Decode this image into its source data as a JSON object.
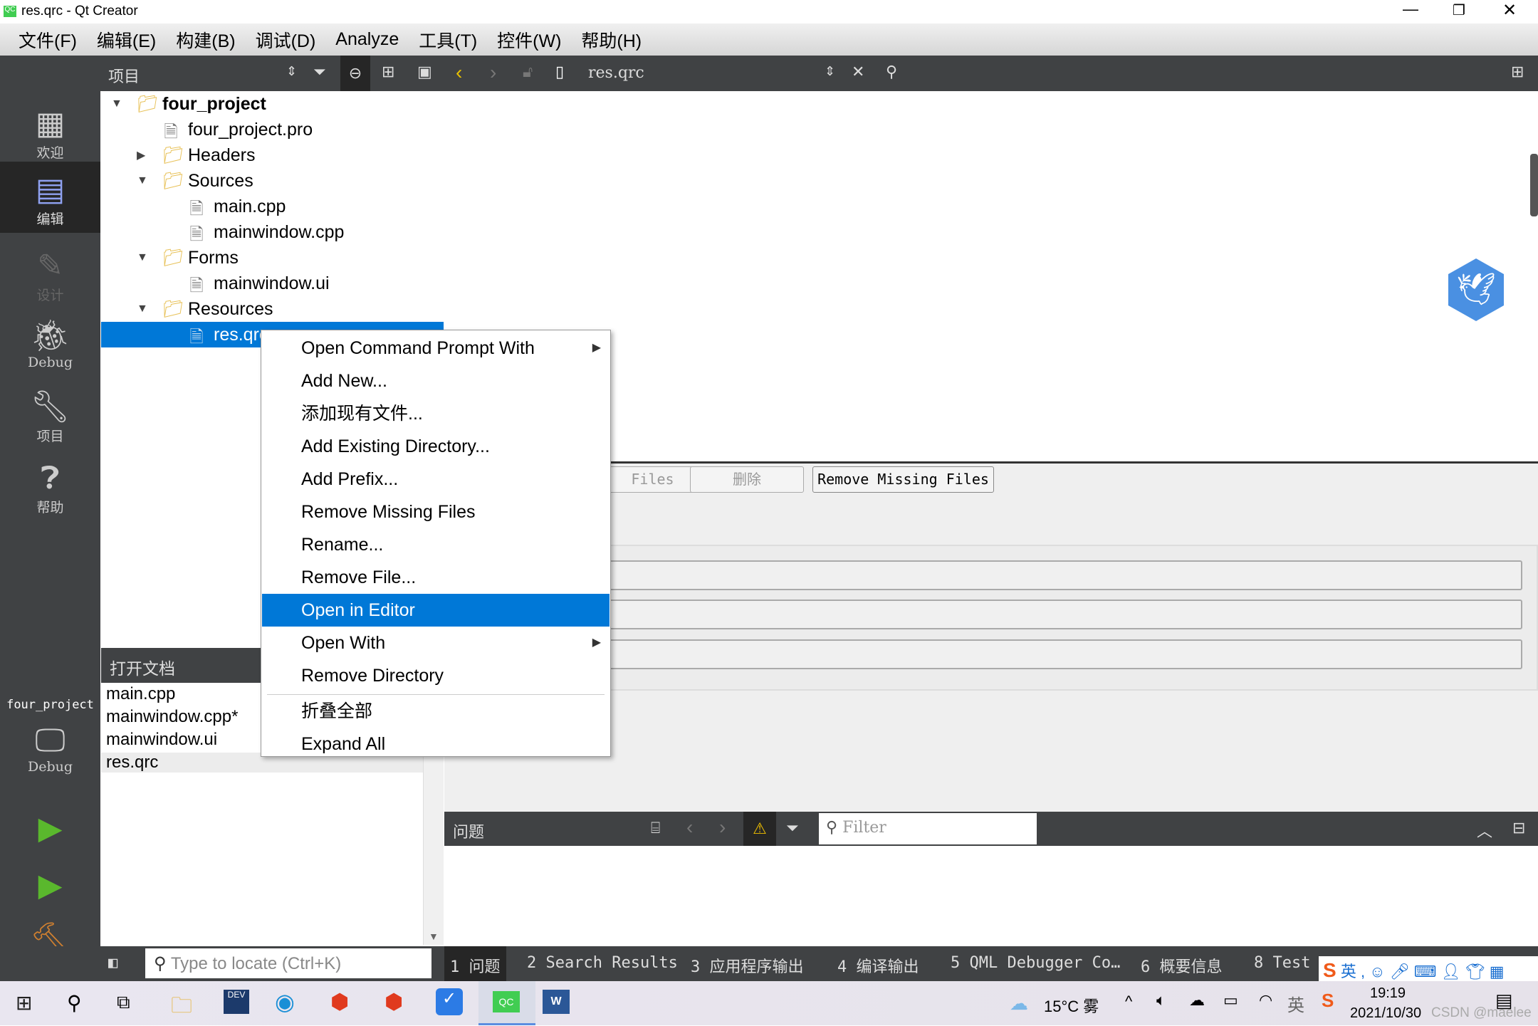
{
  "window": {
    "title": "res.qrc - Qt Creator",
    "icon": "qt-creator-icon",
    "controls": [
      "minimize",
      "restore",
      "close"
    ]
  },
  "menu": [
    "文件(F)",
    "编辑(E)",
    "构建(B)",
    "调试(D)",
    "Analyze",
    "工具(T)",
    "控件(W)",
    "帮助(H)"
  ],
  "toolbar": {
    "panel_title": "项目",
    "open_file": "res.qrc"
  },
  "modes": [
    {
      "label": "欢迎",
      "icon": "grid-icon"
    },
    {
      "label": "编辑",
      "icon": "edit-icon",
      "active": true
    },
    {
      "label": "设计",
      "icon": "pencil-icon",
      "disabled": true
    },
    {
      "label": "Debug",
      "icon": "bug-icon"
    },
    {
      "label": "项目",
      "icon": "wrench-icon"
    },
    {
      "label": "帮助",
      "icon": "help-icon"
    }
  ],
  "kit": {
    "project": "four_project",
    "config": "Debug"
  },
  "tree": [
    {
      "label": "four_project",
      "depth": 0,
      "expanded": true,
      "icon": "qt-folder-icon",
      "bold": true
    },
    {
      "label": "four_project.pro",
      "depth": 1,
      "icon": "pro-file-icon"
    },
    {
      "label": "Headers",
      "depth": 1,
      "expanded": false,
      "icon": "headers-folder-icon"
    },
    {
      "label": "Sources",
      "depth": 1,
      "expanded": true,
      "icon": "sources-folder-icon"
    },
    {
      "label": "main.cpp",
      "depth": 2,
      "icon": "cpp-file-icon"
    },
    {
      "label": "mainwindow.cpp",
      "depth": 2,
      "icon": "cpp-file-icon"
    },
    {
      "label": "Forms",
      "depth": 1,
      "expanded": true,
      "icon": "forms-folder-icon"
    },
    {
      "label": "mainwindow.ui",
      "depth": 2,
      "icon": "ui-file-icon"
    },
    {
      "label": "Resources",
      "depth": 1,
      "expanded": true,
      "icon": "resources-folder-icon"
    },
    {
      "label": "res.qrc",
      "depth": 2,
      "icon": "qrc-file-icon",
      "selected": true
    }
  ],
  "open_docs": {
    "title": "打开文档",
    "items": [
      "main.cpp",
      "mainwindow.cpp*",
      "mainwindow.ui",
      "res.qrc"
    ]
  },
  "context_menu": [
    {
      "label": "Open Command Prompt With",
      "submenu": true
    },
    {
      "label": "Add New..."
    },
    {
      "label": "添加现有文件..."
    },
    {
      "label": "Add Existing Directory..."
    },
    {
      "label": "Add Prefix..."
    },
    {
      "label": "Remove Missing Files"
    },
    {
      "label": "Rename..."
    },
    {
      "label": "Remove File..."
    },
    {
      "label": "Open in Editor",
      "highlighted": true
    },
    {
      "label": "Open With",
      "submenu": true
    },
    {
      "label": "Remove Directory"
    },
    {
      "label": "折叠全部",
      "separator_before": true
    },
    {
      "label": "Expand All"
    }
  ],
  "resource_editor": {
    "buttons": [
      "Files",
      "删除",
      "Remove Missing Files"
    ]
  },
  "problems": {
    "title": "问题",
    "filter_placeholder": "Filter"
  },
  "locator_placeholder": "Type to locate (Ctrl+K)",
  "output_tabs": [
    "1 问题",
    "2 Search Results",
    "3 应用程序输出",
    "4 编译输出",
    "5 QML Debugger Co…",
    "6 概要信息",
    "8 Test"
  ],
  "ime": {
    "lang": "英"
  },
  "taskbar": {
    "weather": "15°C 雾",
    "ime": "英",
    "time": "19:19",
    "date": "2021/10/30",
    "watermark": "CSDN @maelee"
  },
  "colors": {
    "dark": "#404244",
    "selection": "#0078d7",
    "mode_active": "#262626"
  }
}
